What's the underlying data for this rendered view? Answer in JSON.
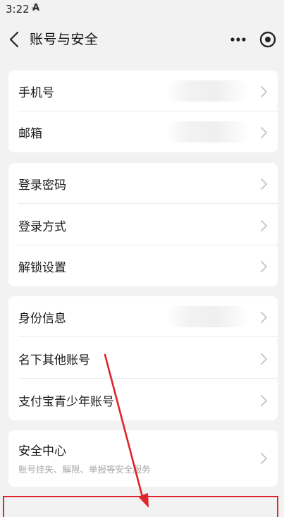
{
  "status_bar": {
    "time": "3:22",
    "app_icon_glyph": "A̶"
  },
  "nav": {
    "title": "账号与安全"
  },
  "groups": [
    {
      "rows": [
        {
          "label": "手机号",
          "value_hidden": true
        },
        {
          "label": "邮箱",
          "value_hidden": true
        }
      ]
    },
    {
      "rows": [
        {
          "label": "登录密码"
        },
        {
          "label": "登录方式"
        },
        {
          "label": "解锁设置"
        }
      ]
    },
    {
      "rows": [
        {
          "label": "身份信息",
          "value_hidden": true
        },
        {
          "label": "名下其他账号"
        },
        {
          "label": "支付宝青少年账号"
        }
      ]
    },
    {
      "rows": [
        {
          "label": "安全中心",
          "subtitle": "账号挂失、解限、举报等安全服务"
        }
      ]
    }
  ],
  "colors": {
    "background": "#f2f2f2",
    "card": "#ffffff",
    "annotation_red": "#e0232a",
    "chevron": "#c4c4c4",
    "subtitle": "#a8a8a8"
  },
  "icons": {
    "back": "chevron-left-icon",
    "more": "more-dots-icon",
    "miniapp": "target-circle-icon",
    "row_arrow": "chevron-right-icon"
  }
}
